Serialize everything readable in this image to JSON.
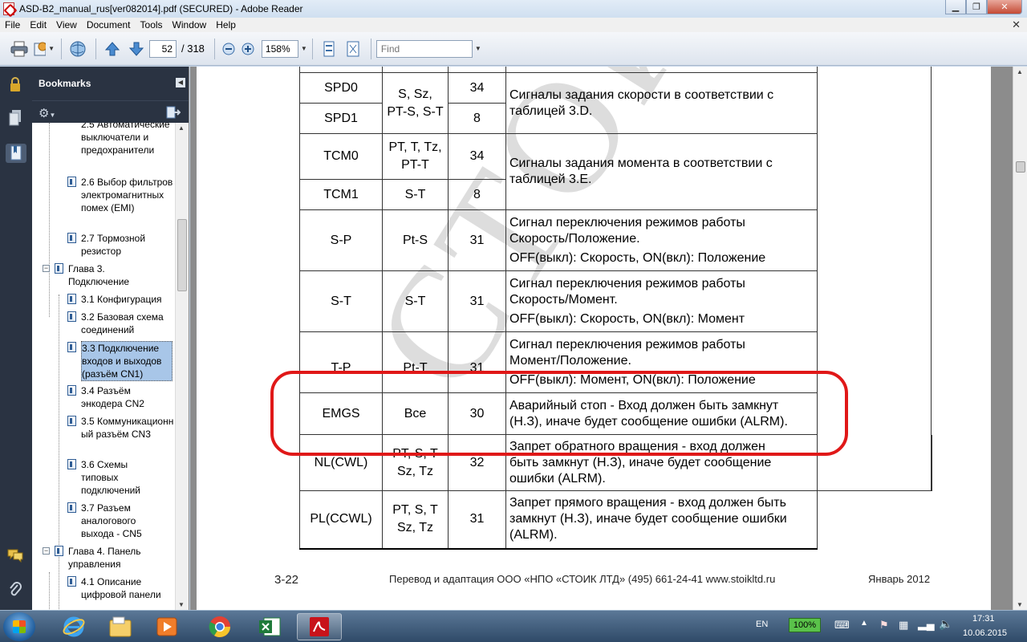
{
  "window": {
    "title": "ASD-B2_manual_rus[ver082014].pdf (SECURED) - Adobe Reader"
  },
  "menu": [
    "File",
    "Edit",
    "View",
    "Document",
    "Tools",
    "Window",
    "Help"
  ],
  "toolbar": {
    "page_current": "52",
    "page_total": "/ 318",
    "zoom": "158%",
    "find_placeholder": "Find"
  },
  "bookmarks": {
    "header": "Bookmarks",
    "items": [
      {
        "label": "2.5 Автоматические выключатели и предохранители"
      },
      {
        "label": "2.6 Выбор фильтров электромагнитных помех (EMI)"
      },
      {
        "label": "2.7 Тормозной резистор"
      },
      {
        "label": "Глава 3. Подключение"
      },
      {
        "label": "3.1 Конфигурация"
      },
      {
        "label": "3.2 Базовая схема соединений"
      },
      {
        "label": "3.3 Подключение входов и выходов (разъём CN1)"
      },
      {
        "label": "3.4 Разъём энкодера CN2"
      },
      {
        "label": "3.5 Коммуникационный разъём CN3"
      },
      {
        "label": "3.6 Схемы типовых подключений"
      },
      {
        "label": "3.7 Разъем аналогового выхода - CN5"
      },
      {
        "label": "Глава 4. Панель управления"
      },
      {
        "label": "4.1 Описание цифровой панели"
      }
    ]
  },
  "document": {
    "watermark": "СТОИК",
    "rows": [
      {
        "name": "SPD0",
        "mode": "S, Sz,",
        "code": "34",
        "desc": "Сигналы задания скорости в соответствии с"
      },
      {
        "name": "SPD1",
        "mode": "PT-S, S-T",
        "code": "8",
        "desc": "таблицей 3.D."
      },
      {
        "name": "TCM0",
        "mode": "PT, T, Tz,",
        "mode2": "PT-T",
        "code": "34",
        "desc": "Сигналы задания момента в соответствии с",
        "desc2": "таблицей 3.E."
      },
      {
        "name": "TCM1",
        "mode": "S-T",
        "code": "8"
      },
      {
        "name": "S-P",
        "mode": "Pt-S",
        "code": "31",
        "desc": "Сигнал переключения режимов работы",
        "desc2": "Скорость/Положение.",
        "desc3": "OFF(выкл): Скорость, ON(вкл): Положение"
      },
      {
        "name": "S-T",
        "mode": "S-T",
        "code": "31",
        "desc": "Сигнал переключения режимов работы",
        "desc2": "Скорость/Момент.",
        "desc3": "OFF(выкл): Скорость, ON(вкл): Момент"
      },
      {
        "name": "T-P",
        "mode": "Pt-T",
        "code": "31",
        "desc": "Сигнал переключения режимов работы",
        "desc2": "Момент/Положение.",
        "desc3": "OFF(выкл): Момент, ON(вкл): Положение"
      },
      {
        "name": "EMGS",
        "mode": "Все",
        "code": "30",
        "desc": "Аварийный стоп - Вход должен быть замкнут",
        "desc2": "(Н.З), иначе будет сообщение ошибки (ALRM)."
      },
      {
        "name": "NL(CWL)",
        "mode": "PT, S, T",
        "mode2": "Sz, Tz",
        "code": "32",
        "desc": "Запрет обратного вращения - вход должен",
        "desc2": "быть замкнут (Н.З), иначе будет сообщение",
        "desc3": "ошибки (ALRM)."
      },
      {
        "name": "PL(CCWL)",
        "mode": "PT, S, T",
        "mode2": "Sz, Tz",
        "code": "31",
        "desc": "Запрет прямого вращения - вход должен быть",
        "desc2": "замкнут (Н.З), иначе будет сообщение ошибки",
        "desc3": "(ALRM)."
      }
    ],
    "footer_page": "3-22",
    "footer_mid": "Перевод и адаптация ООО «НПО «СТОИК ЛТД» (495) 661-24-41 www.stoikltd.ru",
    "footer_date": "Январь 2012"
  },
  "taskbar": {
    "lang": "EN",
    "battery": "100%",
    "time": "17:31",
    "date": "10.06.2015"
  }
}
